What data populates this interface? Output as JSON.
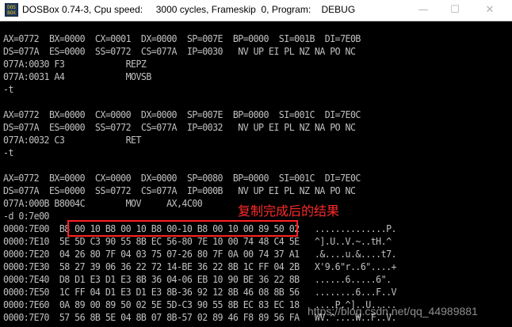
{
  "window": {
    "title": "DOSBox 0.74-3, Cpu speed:     3000 cycles, Frameskip  0, Program:    DEBUG",
    "app_icon_text": "DOS BOX",
    "minimize_glyph": "—",
    "maximize_glyph": "☐",
    "close_glyph": "✕"
  },
  "console": {
    "lines": [
      "AX=0772  BX=0000  CX=0001  DX=0000  SP=007E  BP=0000  SI=001B  DI=7E0B",
      "DS=077A  ES=0000  SS=0772  CS=077A  IP=0030   NV UP EI PL NZ NA PO NC",
      "077A:0030 F3            REPZ",
      "077A:0031 A4            MOVSB",
      "-t",
      "",
      "AX=0772  BX=0000  CX=0000  DX=0000  SP=007E  BP=0000  SI=001C  DI=7E0C",
      "DS=077A  ES=0000  SS=0772  CS=077A  IP=0032   NV UP EI PL NZ NA PO NC",
      "077A:0032 C3            RET",
      "-t",
      "",
      "AX=0772  BX=0000  CX=0000  DX=0000  SP=0080  BP=0000  SI=001C  DI=7E0C",
      "DS=077A  ES=0000  SS=0772  CS=077A  IP=000B   NV UP EI PL NZ NA PO NC",
      "077A:000B B8004C        MOV     AX,4C00",
      "-d 0:7e00",
      "0000:7E00  B8 00 10 B8 00 10 B8 00-10 B8 00 10 00 89 50 02   ..............P.",
      "0000:7E10  5E 5D C3 90 55 8B EC 56-80 7E 10 00 74 48 C4 5E   ^].U..V.~..tH.^",
      "0000:7E20  04 26 80 7F 04 03 75 07-26 80 7F 0A 00 74 37 A1   .&....u.&....t7.",
      "0000:7E30  58 27 39 06 36 22 72 14-BE 36 22 8B 1C FF 04 2B   X'9.6\"r..6\"....+",
      "0000:7E40  D8 D1 E3 D1 E3 8B 36 04-06 EB 10 90 BE 36 22 8B   ......6.....6\".",
      "0000:7E50  1C FF 04 D1 E3 D1 E3 8B-36 92 12 8B 46 08 8B 56   ........6...F..V",
      "0000:7E60  0A 89 00 89 50 02 5E 5D-C3 90 55 8B EC 83 EC 18   ....P.^]..U.....",
      "0000:7E70  57 56 8B 5E 04 8B 07 8B-57 02 89 46 F8 89 56 FA   WV.^....W..F..V."
    ],
    "annotation_label": "复制完成后的结果",
    "watermark": "https://blog.csdn.net/qq_44989881"
  },
  "colors": {
    "console_bg": "#000000",
    "console_text": "#c0c0c0",
    "annotation": "#ff2020",
    "titlebar_bg": "#ffffff"
  }
}
